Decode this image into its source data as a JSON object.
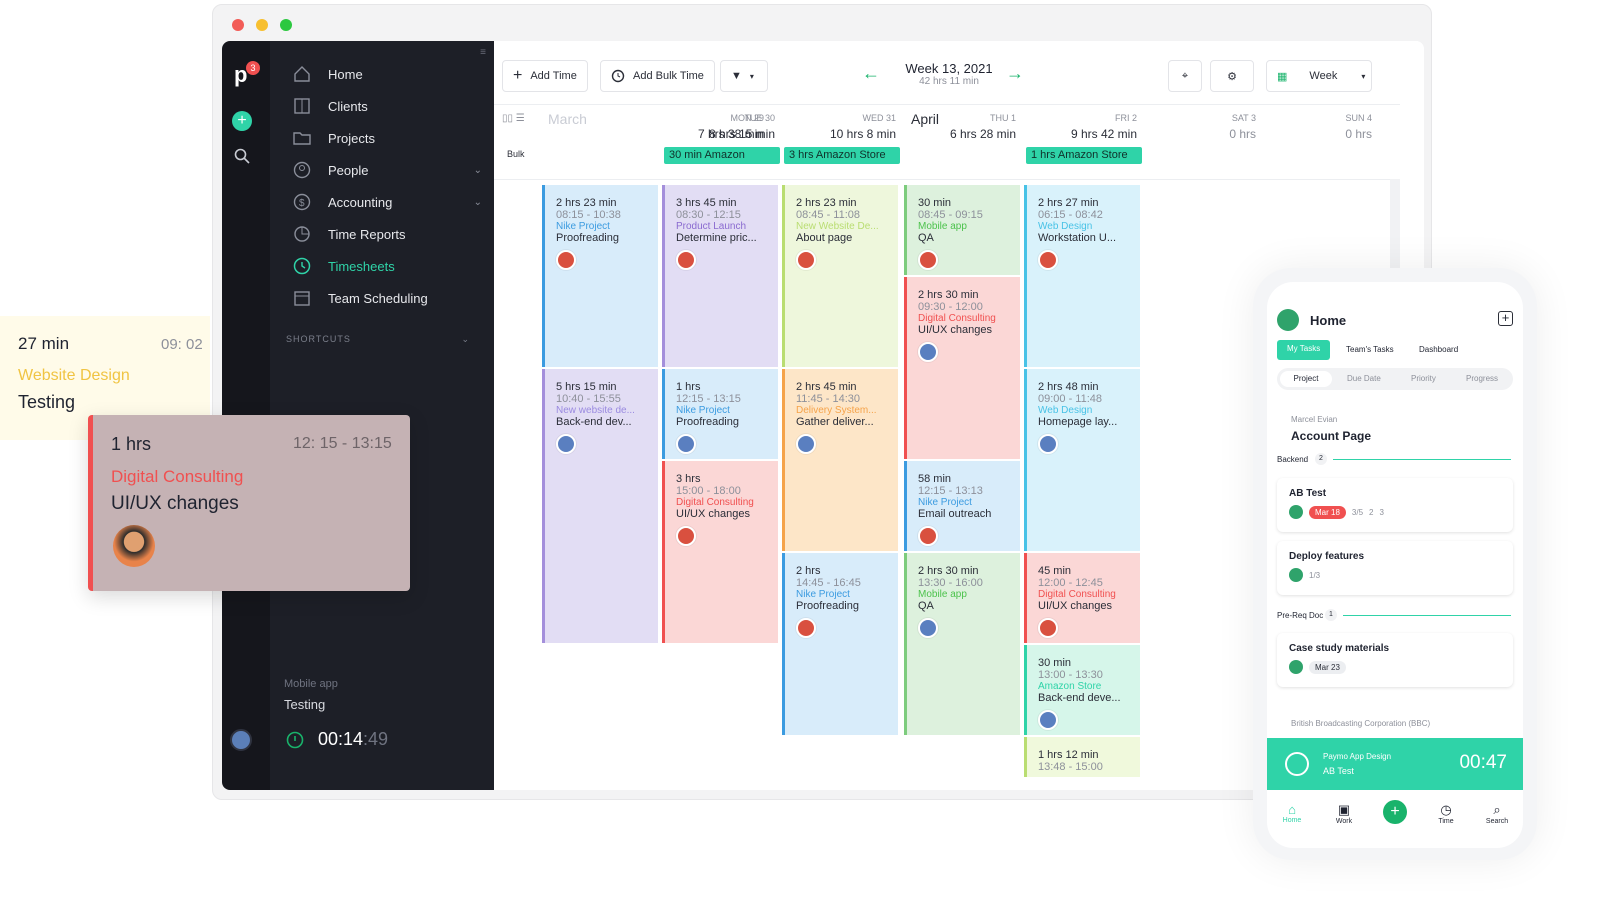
{
  "sidebar": {
    "badge": "3",
    "nav": [
      "Home",
      "Clients",
      "Projects",
      "People",
      "Accounting",
      "Time Reports",
      "Timesheets",
      "Team Scheduling"
    ],
    "active": "Timesheets",
    "shortcuts_label": "SHORTCUTS",
    "timer_project": "Mobile app",
    "timer_task": "Testing",
    "timer_main": "00:14",
    "timer_sec": ":49"
  },
  "toolbar": {
    "add_time": "Add Time",
    "add_bulk_time": "Add Bulk Time",
    "week_title": "Week 13, 2021",
    "week_total": "42 hrs 11 min",
    "view": "Week"
  },
  "calendar": {
    "bulk": "Bulk",
    "month1": "March",
    "month2": "April",
    "days": [
      {
        "day": "MON 29",
        "hours": "7 hrs 38 min"
      },
      {
        "day": "TUE 30",
        "hours": "8 hrs 15 min"
      },
      {
        "day": "WED 31",
        "hours": "10 hrs 8 min"
      },
      {
        "day": "THU 1",
        "hours": "6 hrs 28 min"
      },
      {
        "day": "FRI 2",
        "hours": "9 hrs 42 min"
      },
      {
        "day": "SAT 3",
        "hours": "0 hrs"
      },
      {
        "day": "SUN 4",
        "hours": "0 hrs"
      }
    ],
    "tags": [
      "30 min Amazon",
      "3 hrs Amazon Store",
      "1 hrs Amazon Store"
    ],
    "cols": [
      [
        {
          "d": "2 hrs 23 min",
          "t": "08:15 - 10:38",
          "p": "Nike Project",
          "n": "Proofreading"
        },
        {
          "d": "5 hrs 15 min",
          "t": "10:40 - 15:55",
          "p": "New website de...",
          "n": "Back-end dev..."
        }
      ],
      [
        {
          "d": "3 hrs 45 min",
          "t": "08:30 - 12:15",
          "p": "Product Launch",
          "n": "Determine pric..."
        },
        {
          "d": "1 hrs",
          "t": "12:15 - 13:15",
          "p": "Nike Project",
          "n": "Proofreading"
        },
        {
          "d": "3 hrs",
          "t": "15:00 - 18:00",
          "p": "Digital Consulting",
          "n": "UI/UX changes"
        }
      ],
      [
        {
          "d": "2 hrs 23 min",
          "t": "08:45 - 11:08",
          "p": "New Website De...",
          "n": "About page"
        },
        {
          "d": "2 hrs 45 min",
          "t": "11:45 - 14:30",
          "p": "Delivery System...",
          "n": "Gather deliver..."
        },
        {
          "d": "2 hrs",
          "t": "14:45 - 16:45",
          "p": "Nike Project",
          "n": "Proofreading"
        }
      ],
      [
        {
          "d": "30 min",
          "t": "08:45 - 09:15",
          "p": "Mobile app",
          "n": "QA"
        },
        {
          "d": "2 hrs 30 min",
          "t": "09:30 - 12:00",
          "p": "Digital Consulting",
          "n": "UI/UX changes"
        },
        {
          "d": "58 min",
          "t": "12:15 - 13:13",
          "p": "Nike Project",
          "n": "Email outreach"
        },
        {
          "d": "2 hrs 30 min",
          "t": "13:30 - 16:00",
          "p": "Mobile app",
          "n": "QA"
        }
      ],
      [
        {
          "d": "2 hrs 27 min",
          "t": "06:15 - 08:42",
          "p": "Web Design",
          "n": "Workstation U..."
        },
        {
          "d": "2 hrs 48 min",
          "t": "09:00 - 11:48",
          "p": "Web Design",
          "n": "Homepage lay..."
        },
        {
          "d": "45 min",
          "t": "12:00 - 12:45",
          "p": "Digital Consulting",
          "n": "UI/UX changes"
        },
        {
          "d": "30 min",
          "t": "13:00 - 13:30",
          "p": "Amazon Store",
          "n": "Back-end deve..."
        },
        {
          "d": "1 hrs 12 min",
          "t": "13:48 - 15:00",
          "p": "",
          "n": ""
        }
      ]
    ]
  },
  "float1": {
    "dur": "27 min",
    "time": "09: 02",
    "project": "Website Design",
    "task": "Testing"
  },
  "float2": {
    "dur": "1 hrs",
    "time": "12: 15 - 13:15",
    "project": "Digital Consulting",
    "task": "UI/UX changes"
  },
  "phone": {
    "title": "Home",
    "tabs": [
      "My Tasks",
      "Team's Tasks",
      "Dashboard"
    ],
    "sorts": [
      "Project",
      "Due Date",
      "Priority",
      "Progress"
    ],
    "client": "Marcel Evian",
    "project": "Account Page",
    "group1": "Backend",
    "group1_count": "2",
    "t1": "AB Test",
    "t1_date": "Mar 18",
    "t1_sub": "3/5",
    "t1_com": "2",
    "t1_att": "3",
    "t2": "Deploy features",
    "t2_sub": "1/3",
    "group2": "Pre-Req Doc",
    "group2_count": "1",
    "t3": "Case study materials",
    "t3_date": "Mar 23",
    "client2": "British Broadcasting Corporation (BBC)",
    "timer_project": "Paymo App Design",
    "timer_task": "AB Test",
    "timer": "00:47",
    "nav": [
      "Home",
      "Work",
      "Time",
      "Search"
    ]
  },
  "colors": {
    "accent": "#2fd3a8",
    "green": "#19b36b",
    "danger": "#f05050"
  }
}
